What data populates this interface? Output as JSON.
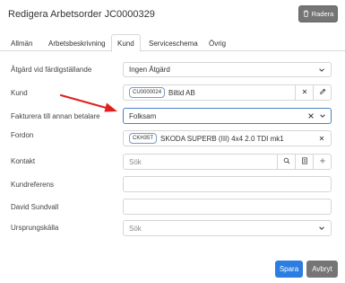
{
  "dialog": {
    "title": "Redigera Arbetsorder JC0000329",
    "delete_label": "Radera"
  },
  "tabs": [
    {
      "label": "Allmän"
    },
    {
      "label": "Arbetsbeskrivning"
    },
    {
      "label": "Kund"
    },
    {
      "label": "Serviceschema"
    },
    {
      "label": "Övrig"
    }
  ],
  "form": {
    "atgard": {
      "label": "Åtgärd vid färdigställande",
      "value": "Ingen Åtgärd"
    },
    "kund": {
      "label": "Kund",
      "tag": "CU0000024",
      "value": "Biltid AB"
    },
    "fakturera": {
      "label": "Fakturera till annan betalare",
      "value": "Folksam"
    },
    "fordon": {
      "label": "Fordon",
      "tag": "CKH35T",
      "value": "SKODA SUPERB (III) 4x4 2.0 TDI mk1"
    },
    "kontakt": {
      "label": "Kontakt",
      "placeholder": "Sök"
    },
    "kundreferens": {
      "label": "Kundreferens",
      "value": ""
    },
    "david": {
      "label": "David Sundvall",
      "value": ""
    },
    "ursprung": {
      "label": "Ursprungskälla",
      "placeholder": "Sök"
    }
  },
  "footer": {
    "save_label": "Spara",
    "cancel_label": "Avbryt"
  },
  "colors": {
    "primary": "#2b7de1",
    "secondary": "#757575",
    "annotation_arrow": "#e02020",
    "focus_border": "#4d7fc9"
  }
}
